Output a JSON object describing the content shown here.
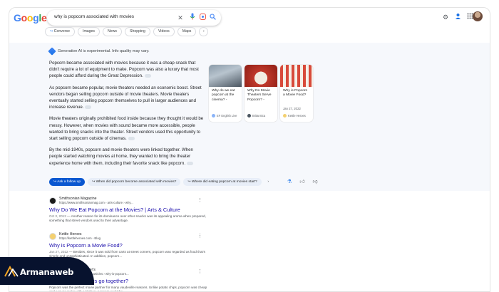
{
  "logo": {
    "letters": [
      "G",
      "o",
      "o",
      "g",
      "l",
      "e"
    ],
    "colors": [
      "#4285f4",
      "#ea4335",
      "#fbbc05",
      "#4285f4",
      "#34a853",
      "#ea4335"
    ]
  },
  "search": {
    "query": "why is popcorn associated with movies"
  },
  "icons": {
    "clear": "close-icon",
    "voice": "mic-icon",
    "lens": "lens-icon",
    "search": "search-icon",
    "settings": "gear-icon",
    "labs": "labs-icon",
    "apps": "apps-grid-icon"
  },
  "chips": [
    "Converse",
    "Images",
    "News",
    "Shopping",
    "Videos",
    "Maps"
  ],
  "ai": {
    "label": "Generative AI is experimental. Info quality may vary.",
    "paragraphs": [
      "Popcorn became associated with movies because it was a cheap snack that didn't require a lot of equipment to make. Popcorn was also a luxury that most people could afford during the Great Depression.",
      "As popcorn became popular, movie theaters needed an economic boost. Street vendors began selling popcorn outside of movie theaters. Movie theaters eventually started selling popcorn themselves to pull in larger audiences and increase revenue.",
      "Movie theaters originally prohibited food inside because they thought it would be messy. However, when movies with sound became more accessible, people wanted to bring snacks into the theater. Street vendors used this opportunity to start selling popcorn outside of cinemas.",
      "By the mid-1940s, popcorn and movie theaters were linked together. When people started watching movies at home, they wanted to bring the theater experience home with them, including their favorite snack like popcorn."
    ],
    "cards": [
      {
        "title": "Why do we eat popcorn at the cinema? -",
        "date": "",
        "source": "EF English Live"
      },
      {
        "title": "Why Do Movie Theaters Serve Popcorn? -",
        "date": "",
        "source": "Britannica"
      },
      {
        "title": "Why is Popcorn a Movie Food?",
        "date": "Jan 27, 2022",
        "source": "Kettle Heroes"
      }
    ],
    "followups": {
      "ask": "Ask a follow up",
      "suggestions": [
        "When did popcorn become associated with movies?",
        "Where did eating popcorn at movies start?"
      ]
    }
  },
  "results": [
    {
      "site": "Smithsonian Magazine",
      "url": "https://www.smithsonianmag.com › arts-culture › why...",
      "title": "Why Do We Eat Popcorn at the Movies? | Arts & Culture",
      "date": "Oct 3, 2013",
      "snippet": "— Another reason for its dominance over other snacks was its appealing aroma when prepared, something that street vendors used to their advantage."
    },
    {
      "site": "Kettle Heroes",
      "url": "https://kettleheroes.com › Blog",
      "title": "Why is Popcorn a Movie Food?",
      "date": "Jan 27, 2022",
      "snippet": "— Besides, since it was sold from carts at street corners, popcorn was regarded as food that's simple and unsophisticated. In addition, popcorn..."
    },
    {
      "site": "Orville Redenbacher's",
      "url": "https://www.orville.com › articles › why-is-popcorn...",
      "title": "Popcorn and movies go together?",
      "date": "",
      "snippet": "Popcorn was the perfect movie partner for many vaudeville reasons. Unlike potato chips, popcorn was cheap and easy to make with a kitchen, popcorn could be..."
    }
  ],
  "watermark": {
    "text": "Armanaweb"
  }
}
